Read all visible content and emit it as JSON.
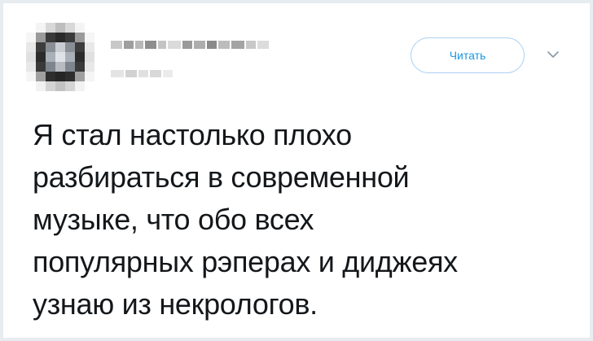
{
  "tweet": {
    "follow_label": "Читать",
    "text_lines": [
      "Я стал настолько плохо",
      "разбираться в современной",
      "музыке, что обо всех",
      "популярных рэперах и диджеях",
      "узнаю из некрологов."
    ]
  },
  "icons": {
    "menu": "chevron-down-icon",
    "avatar": "pixelated-avatar"
  },
  "colors": {
    "accent": "#1b95e0",
    "text": "#14171a",
    "page_background": "#e6ecf0",
    "card_background": "#ffffff"
  }
}
